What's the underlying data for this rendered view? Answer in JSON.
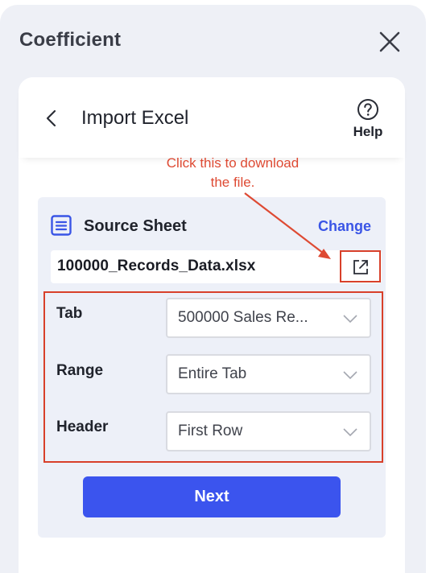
{
  "app": {
    "title": "Coefficient"
  },
  "header": {
    "title": "Import Excel",
    "help_label": "Help"
  },
  "annotation": {
    "text": "Click this to download the file."
  },
  "source": {
    "label": "Source Sheet",
    "change_label": "Change",
    "file_name": "100000_Records_Data.xlsx"
  },
  "fields": [
    {
      "label": "Tab",
      "value": "500000 Sales Re..."
    },
    {
      "label": "Range",
      "value": "Entire Tab"
    },
    {
      "label": "Header",
      "value": "First Row"
    }
  ],
  "actions": {
    "next_label": "Next"
  },
  "colors": {
    "accent": "#3b54ee",
    "annotation": "#de4a33",
    "panel_bg": "#eef0f6"
  },
  "icons": {
    "close": "close-icon",
    "back": "chevron-left-icon",
    "help": "help-circle-icon",
    "sheet": "sheet-icon",
    "external": "external-link-icon",
    "dropdown": "chevron-down-icon"
  }
}
